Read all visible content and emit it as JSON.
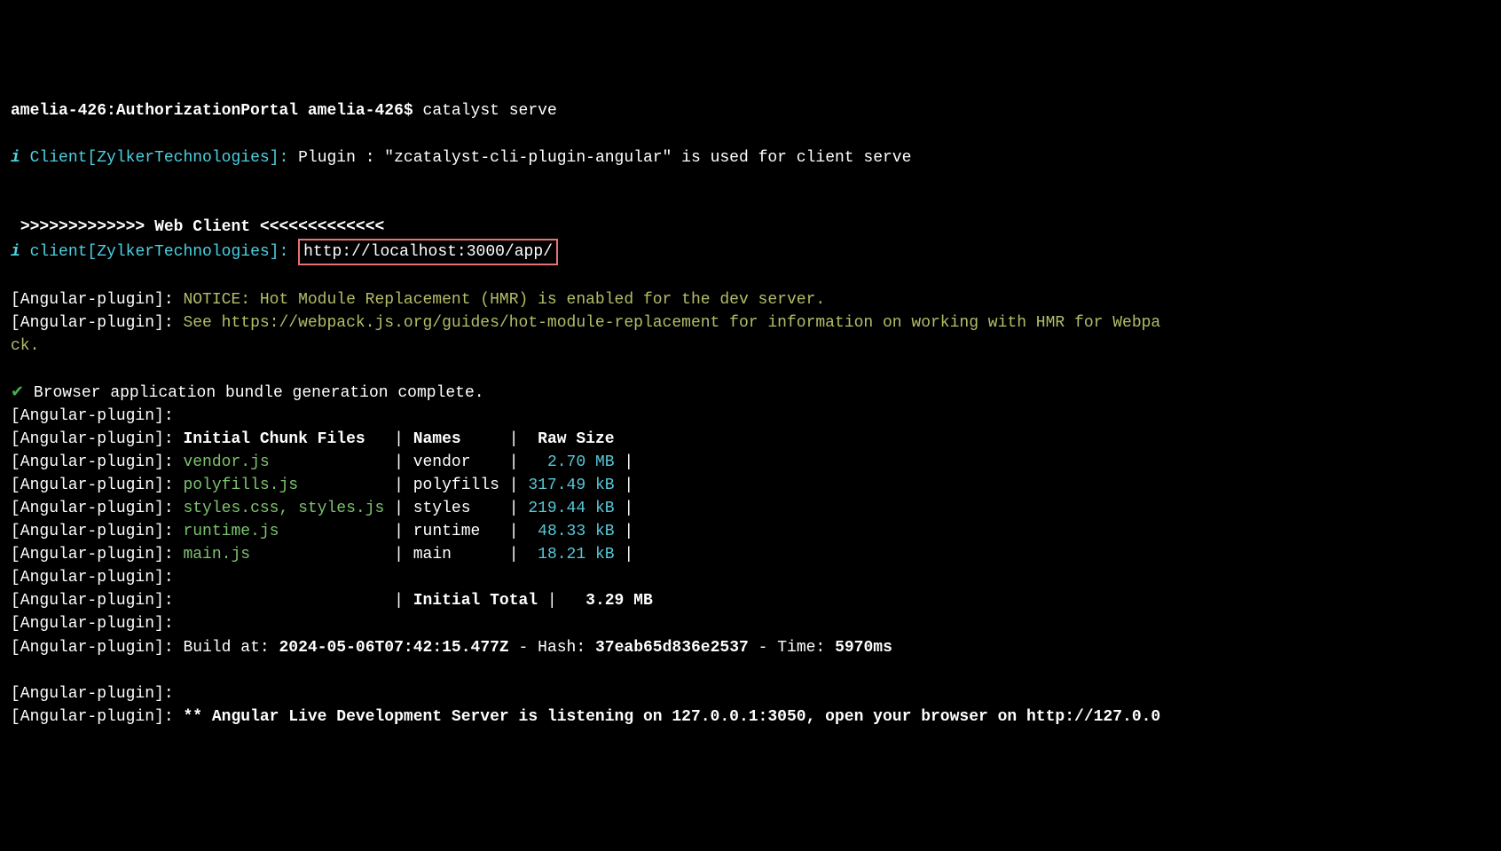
{
  "prompt": {
    "host_path": "amelia-426:AuthorizationPortal",
    "user": "amelia-426$",
    "command": "catalyst serve"
  },
  "client_line": {
    "info_icon": "i",
    "label": "Client[ZylkerTechnologies]:",
    "text": "Plugin : \"zcatalyst-cli-plugin-angular\" is used for client serve"
  },
  "web_client_header": {
    "left": ">>>>>>>>>>>>>",
    "title": "Web Client",
    "right": "<<<<<<<<<<<<<"
  },
  "serve_line": {
    "info_icon": "i",
    "label": "client[ZylkerTechnologies]:",
    "url": "http://localhost:3000/app/"
  },
  "plugin_prefix": "[Angular-plugin]:",
  "notice": {
    "line1": "NOTICE: Hot Module Replacement (HMR) is enabled for the dev server.",
    "line2_a": "See https://webpack.js.org/guides/hot-module-replacement for information on working with HMR for Webpa",
    "line2_b": "ck."
  },
  "bundle_complete": {
    "check": "✔",
    "text": "Browser application bundle generation complete."
  },
  "table": {
    "header": {
      "files": "Initial Chunk Files",
      "names": "Names",
      "size": "Raw Size"
    },
    "rows": [
      {
        "file": "vendor.js",
        "name": "vendor",
        "size": "2.70 MB"
      },
      {
        "file": "polyfills.js",
        "name": "polyfills",
        "size": "317.49 kB"
      },
      {
        "file": "styles.css, styles.js",
        "name": "styles",
        "size": "219.44 kB"
      },
      {
        "file": "runtime.js",
        "name": "runtime",
        "size": "48.33 kB"
      },
      {
        "file": "main.js",
        "name": "main",
        "size": "18.21 kB"
      }
    ],
    "total": {
      "label": "Initial Total",
      "size": "3.29 MB"
    }
  },
  "build_line": {
    "prefix": "Build at:",
    "timestamp": "2024-05-06T07:42:15.477Z",
    "hash_prefix": "- Hash:",
    "hash": "37eab65d836e2537",
    "time_prefix": "- Time:",
    "time": "5970ms"
  },
  "live_server": {
    "text": "** Angular Live Development Server is listening on 127.0.0.1:3050, open your browser on http://127.0.0"
  }
}
